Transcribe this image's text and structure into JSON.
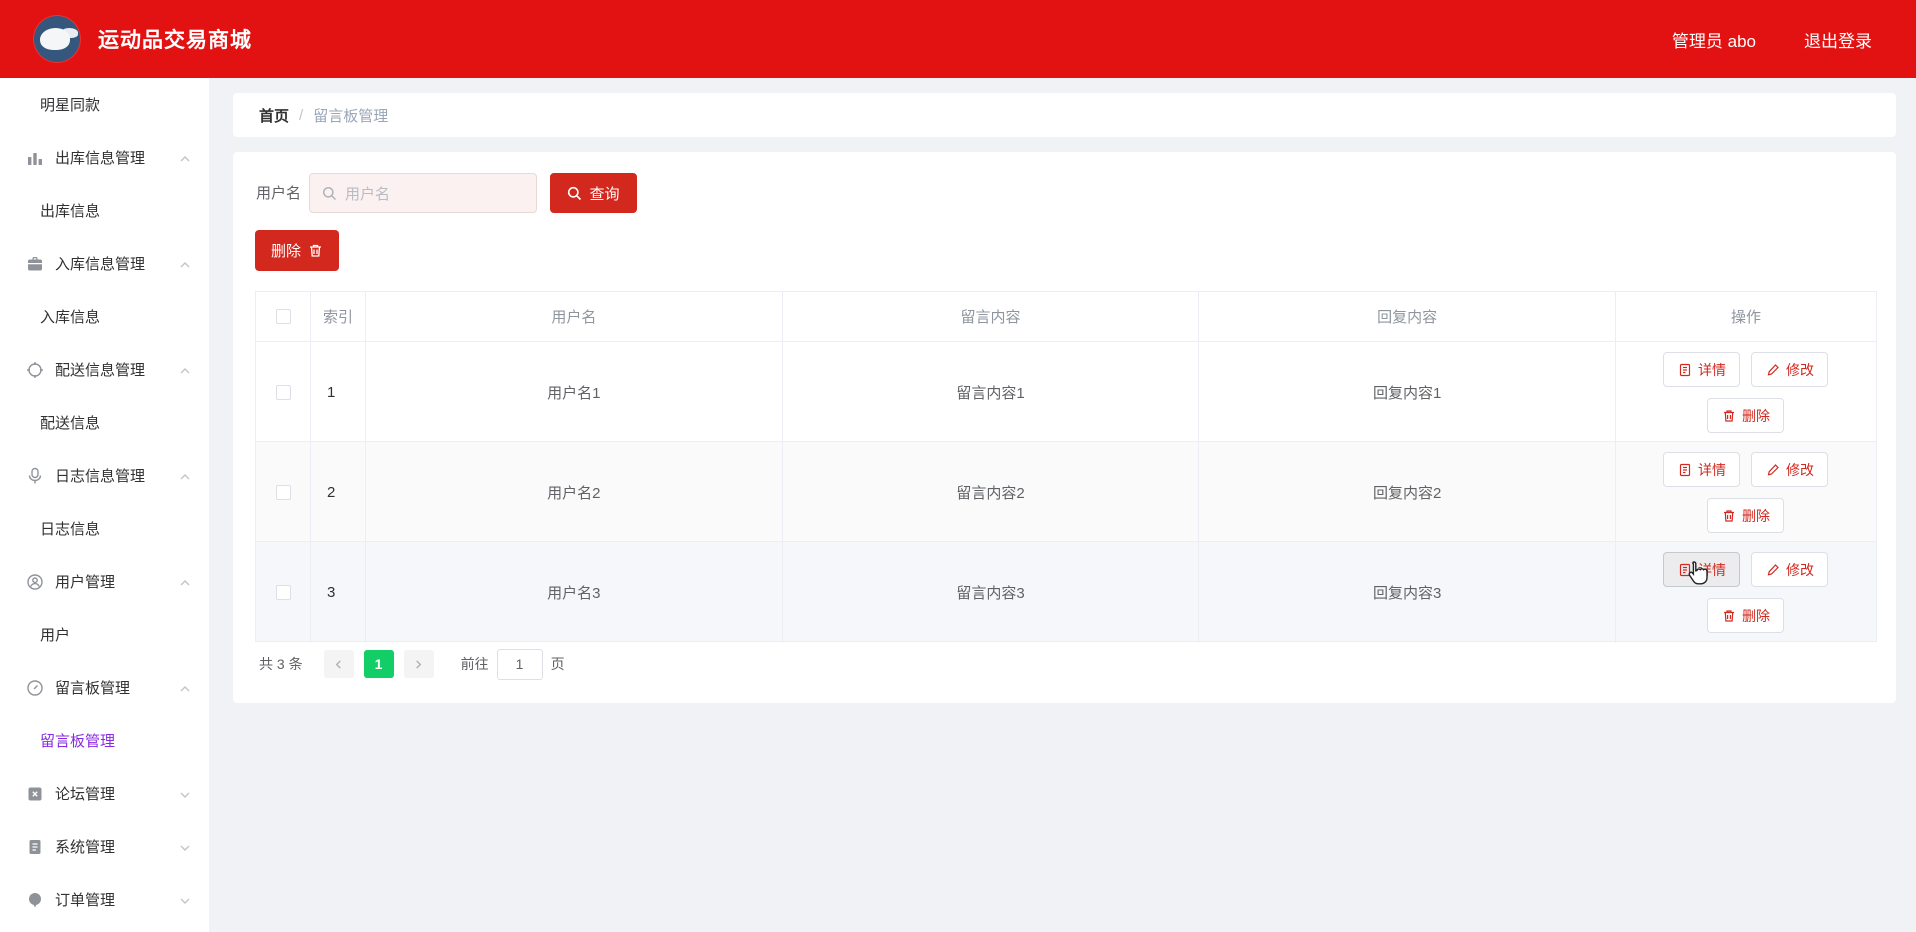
{
  "header": {
    "title": "运动品交易商城",
    "admin_label": "管理员 abo",
    "logout_label": "退出登录"
  },
  "sidebar": {
    "items": [
      {
        "label": "明星同款",
        "type": "plain"
      },
      {
        "label": "出库信息管理",
        "type": "group",
        "icon": "bar-chart-icon",
        "state": "expanded"
      },
      {
        "label": "出库信息",
        "type": "sub"
      },
      {
        "label": "入库信息管理",
        "type": "group",
        "icon": "briefcase-icon",
        "state": "expanded"
      },
      {
        "label": "入库信息",
        "type": "sub"
      },
      {
        "label": "配送信息管理",
        "type": "group",
        "icon": "target-icon",
        "state": "expanded"
      },
      {
        "label": "配送信息",
        "type": "sub"
      },
      {
        "label": "日志信息管理",
        "type": "group",
        "icon": "microphone-icon",
        "state": "expanded"
      },
      {
        "label": "日志信息",
        "type": "sub"
      },
      {
        "label": "用户管理",
        "type": "group",
        "icon": "user-icon",
        "state": "expanded"
      },
      {
        "label": "用户",
        "type": "sub"
      },
      {
        "label": "留言板管理",
        "type": "group",
        "icon": "compass-icon",
        "state": "expanded"
      },
      {
        "label": "留言板管理",
        "type": "sub",
        "active": true
      },
      {
        "label": "论坛管理",
        "type": "group",
        "icon": "forum-icon",
        "state": "collapsed"
      },
      {
        "label": "系统管理",
        "type": "group",
        "icon": "clipboard-icon",
        "state": "collapsed"
      },
      {
        "label": "订单管理",
        "type": "group",
        "icon": "pin-icon",
        "state": "collapsed"
      }
    ]
  },
  "breadcrumb": {
    "home": "首页",
    "separator": "/",
    "current": "留言板管理"
  },
  "search": {
    "label": "用户名",
    "placeholder": "用户名",
    "query_label": "查询"
  },
  "toolbar": {
    "delete_label": "删除"
  },
  "table": {
    "headers": {
      "index": "索引",
      "username": "用户名",
      "message": "留言内容",
      "reply": "回复内容",
      "ops": "操作"
    },
    "actions": {
      "detail": "详情",
      "edit": "修改",
      "del": "删除"
    },
    "rows": [
      {
        "index": "1",
        "username": "用户名1",
        "message": "留言内容1",
        "reply": "回复内容1"
      },
      {
        "index": "2",
        "username": "用户名2",
        "message": "留言内容2",
        "reply": "回复内容2"
      },
      {
        "index": "3",
        "username": "用户名3",
        "message": "留言内容3",
        "reply": "回复内容3"
      }
    ]
  },
  "pagination": {
    "total": "共 3 条",
    "page": "1",
    "goto_prefix": "前往",
    "goto_value": "1",
    "goto_suffix": "页"
  },
  "colors": {
    "header_red": "#e21212",
    "button_red": "#d3281e",
    "active_purple": "#8a2be2",
    "pager_green": "#13ce66",
    "page_bg": "#f0f2f5"
  }
}
